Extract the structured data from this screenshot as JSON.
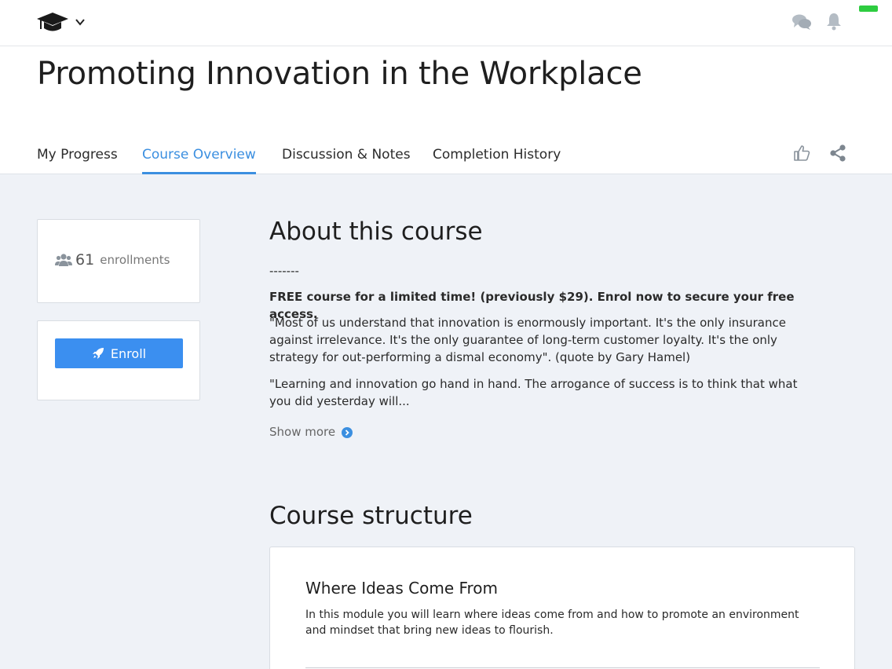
{
  "topbar": {
    "logo_icon": "graduation-cap-icon",
    "menu_icon": "chevron-down-icon",
    "chat_icon": "chat-bubbles-icon",
    "bell_icon": "bell-icon",
    "status_color": "#2ecc40"
  },
  "header": {
    "title": "Promoting Innovation in the Workplace",
    "tabs": [
      {
        "label": "My Progress",
        "active": false
      },
      {
        "label": "Course Overview",
        "active": true
      },
      {
        "label": "Discussion & Notes",
        "active": false
      },
      {
        "label": "Completion History",
        "active": false
      }
    ],
    "like_icon": "thumbs-up-icon",
    "share_icon": "share-icon"
  },
  "sidebar": {
    "enrollments_count": "61",
    "enrollments_label": "enrollments",
    "enroll_button": "Enroll",
    "accent_color": "#3b8ff0"
  },
  "about": {
    "heading": "About this course",
    "separator": "-------",
    "promo": "FREE course for a limited time! (previously $29). Enrol now to secure your free access.",
    "quote1": "\"Most of us understand that innovation is enormously important. It's the only insurance against irrelevance. It's the only guarantee of long-term customer loyalty. It's the only strategy for out-performing a dismal economy\". (quote by Gary Hamel)",
    "quote2": "\"Learning and innovation go hand in hand. The arrogance of success is to think that what you did yesterday will...",
    "show_more": "Show more"
  },
  "structure": {
    "heading": "Course structure",
    "modules": [
      {
        "title": "Where Ideas Come From",
        "description": "In this module you will learn where ideas come from and how to promote an environment and mindset that bring new ideas to flourish."
      }
    ]
  }
}
